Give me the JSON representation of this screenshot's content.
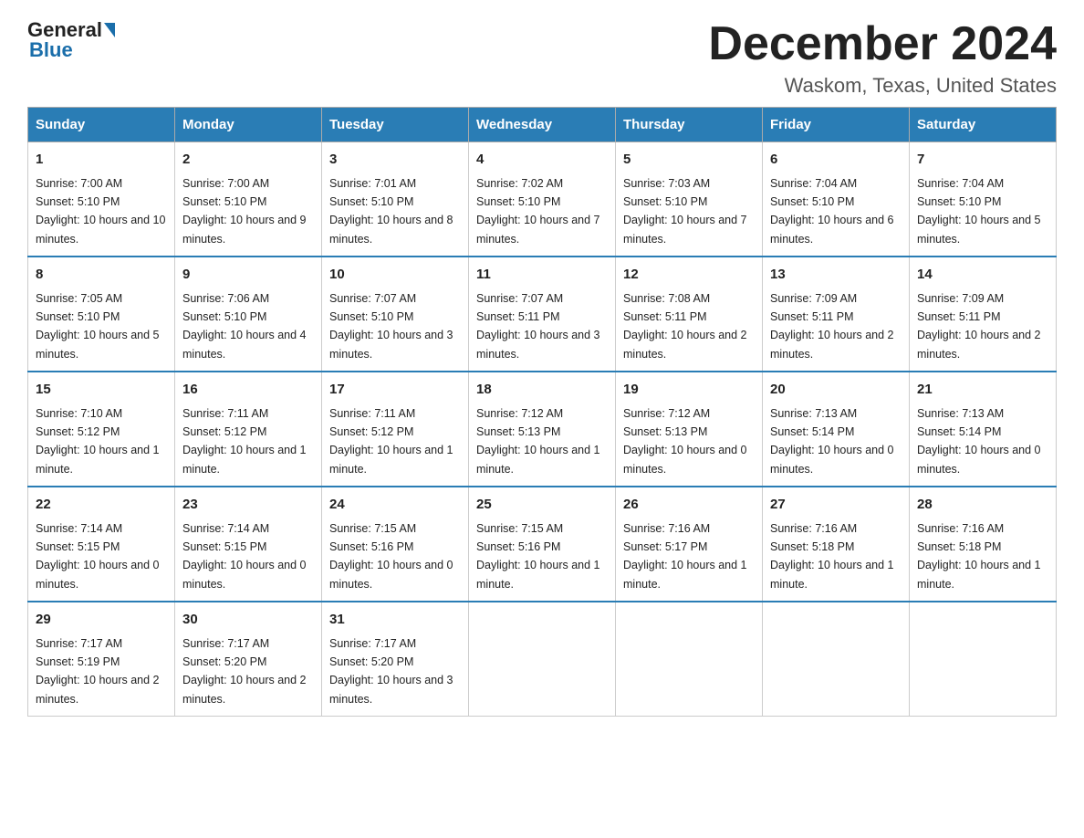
{
  "header": {
    "logo_general": "General",
    "logo_blue": "Blue",
    "month_title": "December 2024",
    "location": "Waskom, Texas, United States"
  },
  "days_of_week": [
    "Sunday",
    "Monday",
    "Tuesday",
    "Wednesday",
    "Thursday",
    "Friday",
    "Saturday"
  ],
  "weeks": [
    [
      {
        "day": "1",
        "sunrise": "7:00 AM",
        "sunset": "5:10 PM",
        "daylight": "10 hours and 10 minutes."
      },
      {
        "day": "2",
        "sunrise": "7:00 AM",
        "sunset": "5:10 PM",
        "daylight": "10 hours and 9 minutes."
      },
      {
        "day": "3",
        "sunrise": "7:01 AM",
        "sunset": "5:10 PM",
        "daylight": "10 hours and 8 minutes."
      },
      {
        "day": "4",
        "sunrise": "7:02 AM",
        "sunset": "5:10 PM",
        "daylight": "10 hours and 7 minutes."
      },
      {
        "day": "5",
        "sunrise": "7:03 AM",
        "sunset": "5:10 PM",
        "daylight": "10 hours and 7 minutes."
      },
      {
        "day": "6",
        "sunrise": "7:04 AM",
        "sunset": "5:10 PM",
        "daylight": "10 hours and 6 minutes."
      },
      {
        "day": "7",
        "sunrise": "7:04 AM",
        "sunset": "5:10 PM",
        "daylight": "10 hours and 5 minutes."
      }
    ],
    [
      {
        "day": "8",
        "sunrise": "7:05 AM",
        "sunset": "5:10 PM",
        "daylight": "10 hours and 5 minutes."
      },
      {
        "day": "9",
        "sunrise": "7:06 AM",
        "sunset": "5:10 PM",
        "daylight": "10 hours and 4 minutes."
      },
      {
        "day": "10",
        "sunrise": "7:07 AM",
        "sunset": "5:10 PM",
        "daylight": "10 hours and 3 minutes."
      },
      {
        "day": "11",
        "sunrise": "7:07 AM",
        "sunset": "5:11 PM",
        "daylight": "10 hours and 3 minutes."
      },
      {
        "day": "12",
        "sunrise": "7:08 AM",
        "sunset": "5:11 PM",
        "daylight": "10 hours and 2 minutes."
      },
      {
        "day": "13",
        "sunrise": "7:09 AM",
        "sunset": "5:11 PM",
        "daylight": "10 hours and 2 minutes."
      },
      {
        "day": "14",
        "sunrise": "7:09 AM",
        "sunset": "5:11 PM",
        "daylight": "10 hours and 2 minutes."
      }
    ],
    [
      {
        "day": "15",
        "sunrise": "7:10 AM",
        "sunset": "5:12 PM",
        "daylight": "10 hours and 1 minute."
      },
      {
        "day": "16",
        "sunrise": "7:11 AM",
        "sunset": "5:12 PM",
        "daylight": "10 hours and 1 minute."
      },
      {
        "day": "17",
        "sunrise": "7:11 AM",
        "sunset": "5:12 PM",
        "daylight": "10 hours and 1 minute."
      },
      {
        "day": "18",
        "sunrise": "7:12 AM",
        "sunset": "5:13 PM",
        "daylight": "10 hours and 1 minute."
      },
      {
        "day": "19",
        "sunrise": "7:12 AM",
        "sunset": "5:13 PM",
        "daylight": "10 hours and 0 minutes."
      },
      {
        "day": "20",
        "sunrise": "7:13 AM",
        "sunset": "5:14 PM",
        "daylight": "10 hours and 0 minutes."
      },
      {
        "day": "21",
        "sunrise": "7:13 AM",
        "sunset": "5:14 PM",
        "daylight": "10 hours and 0 minutes."
      }
    ],
    [
      {
        "day": "22",
        "sunrise": "7:14 AM",
        "sunset": "5:15 PM",
        "daylight": "10 hours and 0 minutes."
      },
      {
        "day": "23",
        "sunrise": "7:14 AM",
        "sunset": "5:15 PM",
        "daylight": "10 hours and 0 minutes."
      },
      {
        "day": "24",
        "sunrise": "7:15 AM",
        "sunset": "5:16 PM",
        "daylight": "10 hours and 0 minutes."
      },
      {
        "day": "25",
        "sunrise": "7:15 AM",
        "sunset": "5:16 PM",
        "daylight": "10 hours and 1 minute."
      },
      {
        "day": "26",
        "sunrise": "7:16 AM",
        "sunset": "5:17 PM",
        "daylight": "10 hours and 1 minute."
      },
      {
        "day": "27",
        "sunrise": "7:16 AM",
        "sunset": "5:18 PM",
        "daylight": "10 hours and 1 minute."
      },
      {
        "day": "28",
        "sunrise": "7:16 AM",
        "sunset": "5:18 PM",
        "daylight": "10 hours and 1 minute."
      }
    ],
    [
      {
        "day": "29",
        "sunrise": "7:17 AM",
        "sunset": "5:19 PM",
        "daylight": "10 hours and 2 minutes."
      },
      {
        "day": "30",
        "sunrise": "7:17 AM",
        "sunset": "5:20 PM",
        "daylight": "10 hours and 2 minutes."
      },
      {
        "day": "31",
        "sunrise": "7:17 AM",
        "sunset": "5:20 PM",
        "daylight": "10 hours and 3 minutes."
      },
      null,
      null,
      null,
      null
    ]
  ]
}
